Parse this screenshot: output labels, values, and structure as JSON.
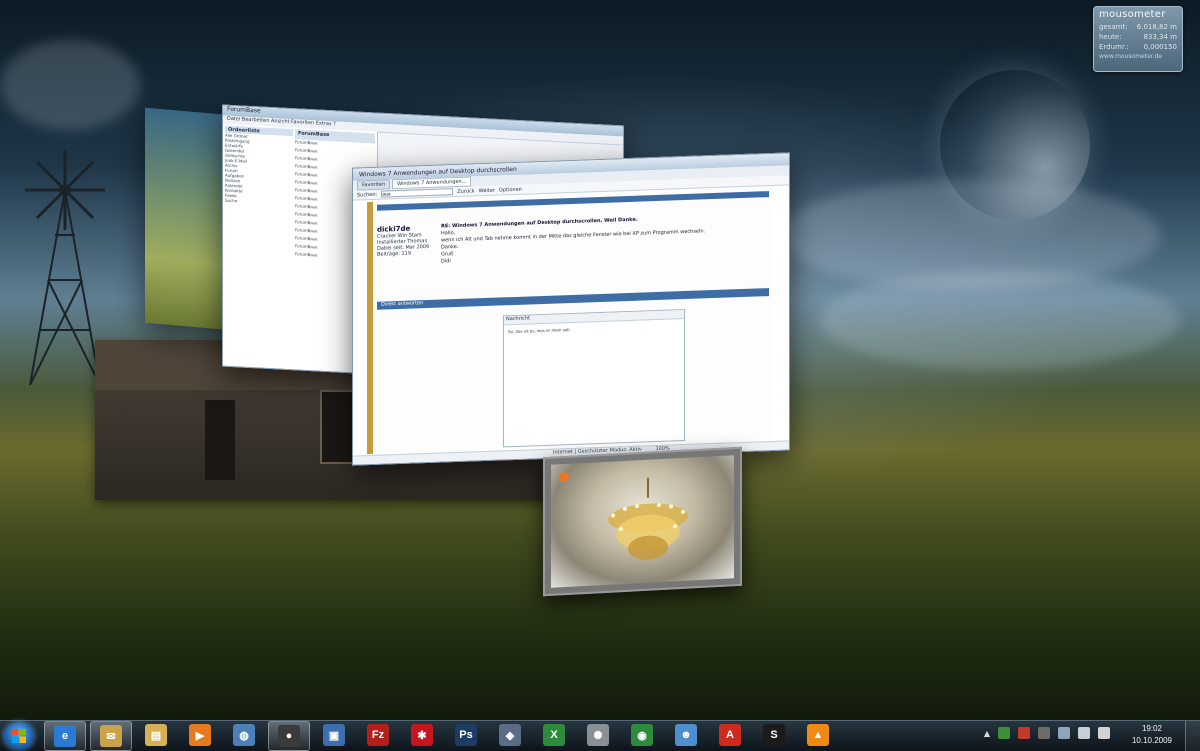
{
  "gadget": {
    "title": "mousometer",
    "rows": [
      {
        "label": "gesamt:",
        "value": "6.018,82 m"
      },
      {
        "label": "heute:",
        "value": "833,34 m"
      },
      {
        "label": "Erdumr.:",
        "value": "0,000150"
      }
    ],
    "url": "www.mousometer.de"
  },
  "windows": {
    "explorer": {
      "title": "ForumBase",
      "menu": "Datei  Bearbeiten  Ansicht  Favoriten  Extras  ?",
      "sidebar_title": "Ordnerliste",
      "list_header": "ForumBase",
      "tree_items": [
        "Alle Ordner",
        "Posteingang",
        "Entwürfe",
        "Gesendet",
        "Gelöschte",
        "Junk-E-Mail",
        "Archiv",
        "Forum",
        "Aufgaben",
        "Notizen",
        "Kalender",
        "Kontakte",
        "Feeds",
        "Suche"
      ],
      "list_items": [
        "ForumBase",
        "ForumBase",
        "ForumBase",
        "ForumBase",
        "ForumBase",
        "ForumBase",
        "ForumBase",
        "ForumBase",
        "ForumBase",
        "ForumBase",
        "ForumBase",
        "ForumBase",
        "ForumBase",
        "ForumBase",
        "ForumBase"
      ]
    },
    "browser": {
      "title": "Windows 7 Anwendungen auf Desktop durchscrollen",
      "tabs": [
        "Favoriten",
        "Windows 7 Anwendungen..."
      ],
      "search_label": "Suchen:",
      "search_value": "desk",
      "nav_labels": [
        "Zurück",
        "Weiter",
        "Optionen"
      ],
      "post_author": "dicki7de",
      "post_meta": [
        "Cracker Win Stars",
        "Installierter Thomas",
        "Dabei seit: Mar 2009",
        "Beiträge: 119"
      ],
      "post_title": "RE: Windows 7 Anwendungen auf Desktop durchscrollen. Weil Danke.",
      "post_lines": [
        "Hallo,",
        "wenn ich Alt und Tab nehme kommt in der Mitte das gleiche Fenster wie bei XP zum Programm wechseln.",
        "Danke.",
        "Gruß",
        "Didi"
      ],
      "reply_header": "Direkt antworten",
      "editor_label": "Nachricht",
      "editor_text": "So, das ist es, was er mein soll.",
      "status_text": "Internet | Geschützter Modus: Aktiv",
      "zoom": "100%"
    }
  },
  "taskbar": {
    "start_label": "Start",
    "apps": [
      {
        "name": "internet-explorer",
        "glyph": "e",
        "color": "#2a7bd1",
        "active": true
      },
      {
        "name": "outlook",
        "glyph": "✉",
        "color": "#c9a24a",
        "active": true
      },
      {
        "name": "explorer",
        "glyph": "▤",
        "color": "#d7b056",
        "active": false
      },
      {
        "name": "media-player",
        "glyph": "▶",
        "color": "#e67a1e",
        "active": false
      },
      {
        "name": "globe",
        "glyph": "◍",
        "color": "#4d7fb8",
        "active": false
      },
      {
        "name": "camera",
        "glyph": "●",
        "color": "#3a3a3a",
        "active": true
      },
      {
        "name": "remote",
        "glyph": "▣",
        "color": "#3d6fb0",
        "active": false
      },
      {
        "name": "filezilla",
        "glyph": "Fz",
        "color": "#b3201b",
        "active": false
      },
      {
        "name": "puzzle",
        "glyph": "✱",
        "color": "#c4161c",
        "active": false
      },
      {
        "name": "photoshop",
        "glyph": "Ps",
        "color": "#1d3c63",
        "active": false
      },
      {
        "name": "box-app",
        "glyph": "◆",
        "color": "#5b6d86",
        "active": false
      },
      {
        "name": "excel",
        "glyph": "X",
        "color": "#2e8b3d",
        "active": false
      },
      {
        "name": "satellite",
        "glyph": "✺",
        "color": "#8a8f98",
        "active": false
      },
      {
        "name": "eye",
        "glyph": "◉",
        "color": "#2d8b3d",
        "active": false
      },
      {
        "name": "messenger",
        "glyph": "☻",
        "color": "#4f8fd0",
        "active": false
      },
      {
        "name": "acrobat",
        "glyph": "A",
        "color": "#cc2b1d",
        "active": false
      },
      {
        "name": "steam",
        "glyph": "S",
        "color": "#1b1b1b",
        "active": false
      },
      {
        "name": "vlc",
        "glyph": "▲",
        "color": "#f08a17",
        "active": false
      }
    ],
    "clock_time": "19:02",
    "clock_date": "10.10.2009"
  }
}
